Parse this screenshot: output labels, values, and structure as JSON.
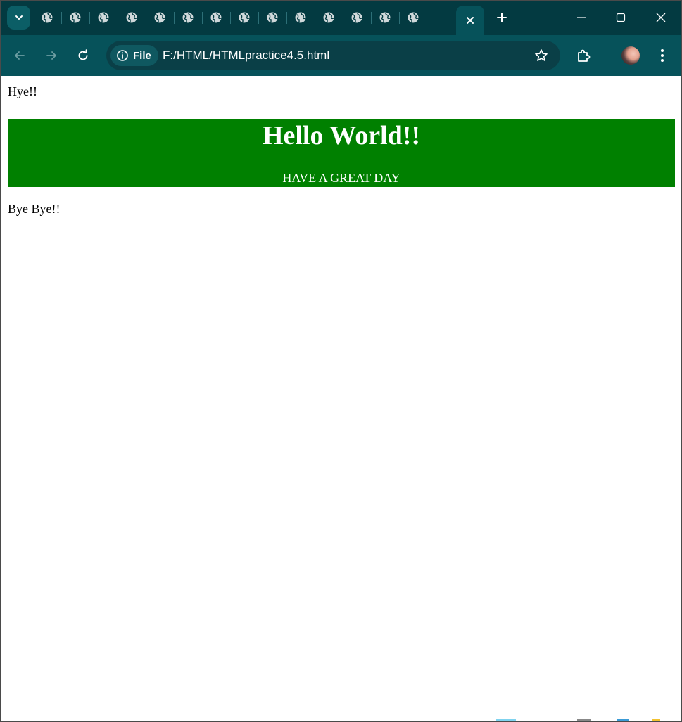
{
  "browser": {
    "tabs_count": 15,
    "active_tab_close_icon": "close-icon",
    "address_chip_label": "File",
    "url": "F:/HTML/HTMLpractice4.5.html"
  },
  "page": {
    "top_text": "Hye!!",
    "banner": {
      "heading": "Hello World!!",
      "subtext": "HAVE A GREAT DAY",
      "background_color": "#008000",
      "text_color": "#ffffff"
    },
    "bottom_text": "Bye Bye!!"
  },
  "colors": {
    "tabstrip": "#033a41",
    "toolbar": "#06525a"
  }
}
